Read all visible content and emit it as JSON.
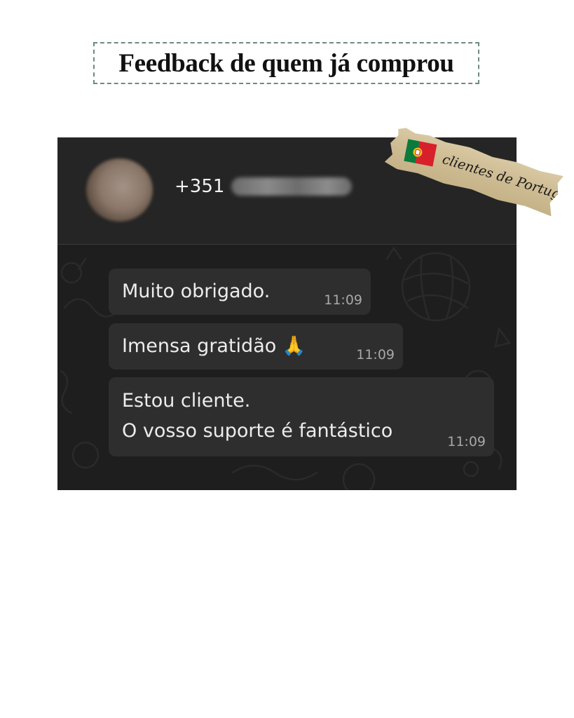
{
  "headline": "Feedback de quem já comprou",
  "badge": {
    "text": "clientes de Portugal",
    "flag_icon": "portugal-flag-icon"
  },
  "chat": {
    "contact_number": "+351",
    "messages": [
      {
        "text": "Muito obrigado.",
        "time": "11:09"
      },
      {
        "text": "Imensa gratidão 🙏",
        "time": "11:09"
      },
      {
        "text": "Estou cliente.\nO vosso suporte é fantástico",
        "time": "11:09"
      }
    ]
  },
  "colors": {
    "frame_border": "#6d8a80",
    "chat_background": "#1e1e1e",
    "bubble_background": "#2e2e2e",
    "timestamp": "#a8a8a8"
  }
}
